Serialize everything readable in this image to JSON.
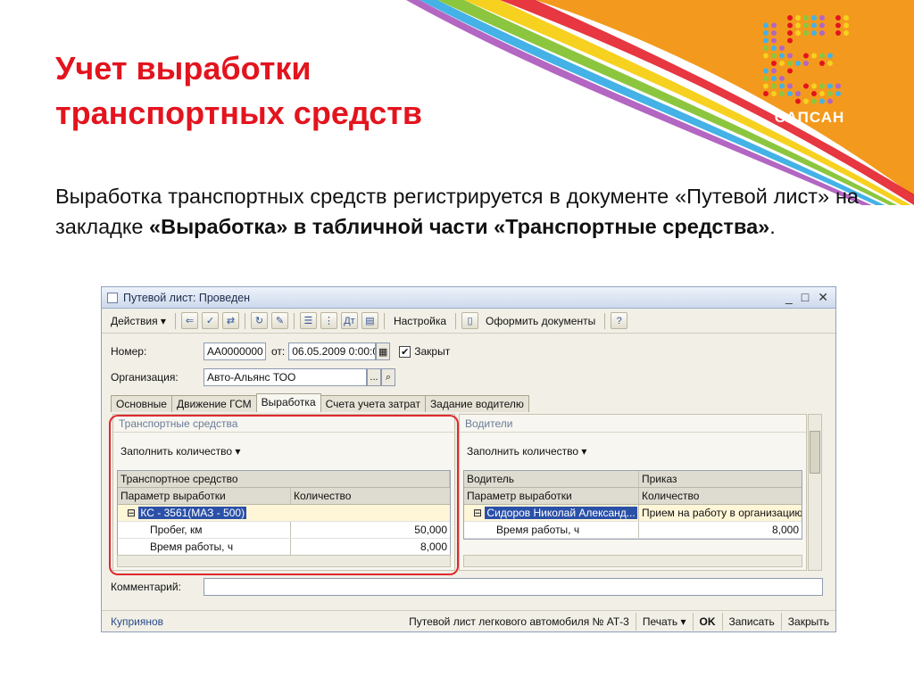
{
  "slide": {
    "title_line1": "Учет выработки",
    "title_line2": "транспортных средств",
    "logo_text": "САПСАН",
    "text_part1": "Выработка транспортных средств регистрируется в документе «Путевой лист» на закладке ",
    "text_bold": "«Выработка» в табличной части «Транспортные средства»",
    "text_end": "."
  },
  "window": {
    "title": "Путевой лист: Проведен",
    "controls": [
      "_",
      "□",
      "✕"
    ],
    "toolbar": {
      "actions_label": "Действия ▾",
      "settings_label": "Настройка",
      "docs_label": "Оформить документы",
      "help_label": "?"
    },
    "number_label": "Номер:",
    "number_value": "АА0000000",
    "from_label": "от:",
    "date_value": "06.05.2009  0:00:0",
    "closed_label": "Закрыт",
    "org_label": "Организация:",
    "org_value": "Авто-Альянс ТОО",
    "tabs": [
      "Основные",
      "Движение ГСМ",
      "Выработка",
      "Счета учета затрат",
      "Задание водителю"
    ],
    "vehicles": {
      "header": "Транспортные средства",
      "fill_button": "Заполнить количество ▾",
      "col_vehicle": "Транспортное средство",
      "col_param": "Параметр выработки",
      "col_qty": "Количество",
      "rows": [
        {
          "name": "КС - 3561(МАЗ - 500)",
          "qty": ""
        },
        {
          "name": "Пробег, км",
          "qty": "50,000"
        },
        {
          "name": "Время работы, ч",
          "qty": "8,000"
        }
      ]
    },
    "drivers": {
      "header": "Водители",
      "fill_button": "Заполнить количество ▾",
      "col_driver": "Водитель",
      "col_order": "Приказ",
      "col_param": "Параметр выработки",
      "col_qty": "Количество",
      "rows": [
        {
          "name": "Сидоров Николай Александ...",
          "order": "Прием на работу в организацию..."
        },
        {
          "name": "Время работы, ч",
          "qty": "8,000"
        }
      ]
    },
    "comment_label": "Комментарий:",
    "comment_value": "",
    "status": {
      "author": "Куприянов",
      "form_name": "Путевой лист легкового автомобиля № АТ-3",
      "print": "Печать ▾",
      "ok": "OK",
      "save": "Записать",
      "close": "Закрыть"
    }
  },
  "colors": {
    "title_red": "#e3141e",
    "orange": "#f39a1e",
    "highlight": "#e1282e"
  }
}
